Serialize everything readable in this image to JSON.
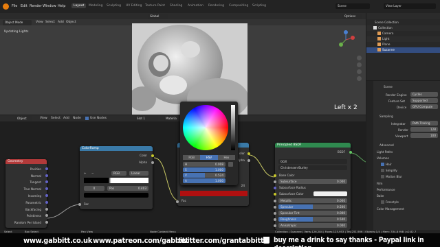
{
  "menu": {
    "items": [
      "File",
      "Edit",
      "Render",
      "Window",
      "Help"
    ],
    "workspaces": [
      "Layout",
      "Modeling",
      "Sculpting",
      "UV Editing",
      "Texture Paint",
      "Shading",
      "Animation",
      "Rendering",
      "Compositing",
      "Scripting"
    ],
    "scene_label": "Scene",
    "view_layer_label": "View Layer"
  },
  "viewport": {
    "mode": "Object Mode",
    "menus": [
      "View",
      "Select",
      "Add",
      "Object"
    ],
    "orientation": "Global",
    "status": "Updating Lights",
    "options": "Options",
    "overlay_text": "Left x 2"
  },
  "outliner": {
    "title": "Scene Collection",
    "items": [
      "Collection",
      "Camera",
      "Light",
      "Plane",
      "Suzanne"
    ]
  },
  "properties": {
    "scene": "Scene",
    "render_engine_label": "Render Engine",
    "render_engine": "Cycles",
    "feature_set_label": "Feature Set",
    "feature_set": "Supported",
    "device_label": "Device",
    "device": "GPU Compute",
    "sampling": "Sampling",
    "integrator_label": "Integrator",
    "integrator": "Path Tracing",
    "render_label": "Render",
    "render_val": "128",
    "viewport_label": "Viewport",
    "viewport_val": "100",
    "advanced": "Advanced",
    "light_paths": "Light Paths",
    "volumes": "Volumes",
    "hair": "Hair",
    "simplify": "Simplify",
    "motion_blur": "Motion Blur",
    "film": "Film",
    "performance": "Performance",
    "bake": "Bake",
    "freestyle": "Freestyle",
    "color_management": "Color Management"
  },
  "node_editor": {
    "editor_type": "Object",
    "menus": [
      "View",
      "Select",
      "Add",
      "Node"
    ],
    "use_nodes": "Use Nodes",
    "slot": "Slot 1",
    "material": "Materia"
  },
  "geometry": {
    "title": "Geometry",
    "outputs": [
      "Position",
      "Normal",
      "Tangent",
      "True Normal",
      "Incoming",
      "Parametric",
      "Backfacing",
      "Pointiness",
      "Random Per Island"
    ]
  },
  "colorramp": {
    "title": "ColorRamp",
    "out_color": "Color",
    "out_alpha": "Alpha",
    "mode": "RGB",
    "interp": "Linear",
    "index": "0",
    "pos_label": "Pos",
    "pos_val": "0.403",
    "fac": "Fac"
  },
  "color_picker": {
    "tabs": [
      "RGB",
      "HSV",
      "Hex"
    ],
    "h_label": "H",
    "h_val": "0.008",
    "s_label": "S",
    "s_val": "1.000",
    "v_label": "V",
    "v_val": "0.524",
    "a_label": "A",
    "a_val": "1.000",
    "fac": "Fac",
    "side_labels": [
      "olor",
      "lpha"
    ],
    "side_val": "24"
  },
  "principled": {
    "title": "Principled BSDF",
    "output": "BSDF",
    "dist": "GGX",
    "sss_method": "Christensen-Burley",
    "base_color": "Base Color",
    "subsurface": "Subsurface",
    "subsurface_val": "0.000",
    "subsurface_radius": "Subsurface Radius",
    "subsurface_color": "Subsurface Color",
    "metallic": "Metallic",
    "metallic_val": "0.000",
    "specular": "Specular",
    "specular_val": "0.500",
    "specular_tint": "Specular Tint",
    "specular_tint_val": "0.000",
    "roughness": "Roughness",
    "roughness_val": "0.500",
    "anisotropic": "Anisotropic",
    "anisotropic_val": "0.000"
  },
  "status": {
    "select": "Select",
    "box_select": "Box Select",
    "pan_view": "Pan View",
    "node_menu": "Node Context Menu",
    "stats": "Collection | Suzanne | Verts:126,284 | Faces:125,953 | Tris:251,906 | Objects:1/4 | Mem: 334.8 MiB | v2.82.7"
  },
  "banner": {
    "site": "www.gabbitt.co.uk",
    "patreon": "www.patreon.com/gabbitt",
    "twitter": "twitter.com/grantabbitt",
    "coffee": "buy me a drink to say thanks - Paypal link in description"
  },
  "colors": {
    "accent": "#4772b3",
    "geometry_header": "#b23a3a",
    "colorramp_header": "#3a7aa8",
    "principled_header": "#2f8a4f",
    "picker_bar": "#b01010"
  }
}
